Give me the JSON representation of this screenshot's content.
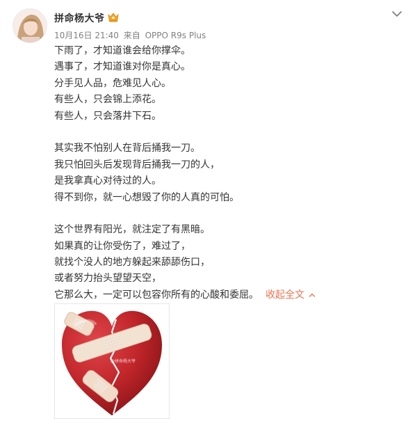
{
  "post": {
    "username": "拼命杨大爷",
    "date": "10月16日 21:40",
    "source_prefix": "来自",
    "device": "OPPO R9s Plus",
    "paragraphs": [
      [
        "下雨了，才知道谁会给你撑伞。",
        "遇事了，才知道谁对你是真心。",
        "分手见人品，危难见人心。",
        "有些人，只会锦上添花。",
        "有些人，只会落井下石。"
      ],
      [
        "其实我不怕别人在背后捅我一刀。",
        "我只怕回头后发现背后捅我一刀的人，",
        "是我拿真心对待过的人。",
        "得不到你，就一心想毁了你的人真的可怕。"
      ],
      [
        "这个世界有阳光，就注定了有黑暗。",
        "如果真的让你受伤了，难过了，",
        "就找个没人的地方躲起来舔舔伤口，",
        "或者努力抬头望望天空，",
        "它那么大，一定可以包容你所有的心酸和委屈。"
      ]
    ],
    "collapse_label": "收起全文",
    "image_caption": "@拼命杨大爷"
  },
  "icons": {
    "vip": "vip-badge-icon",
    "menu": "chevron-down-icon",
    "collapse": "chevron-up-icon"
  },
  "colors": {
    "link": "#eb7350",
    "meta": "#808080",
    "text": "#333333",
    "heart": "#c0262a"
  }
}
